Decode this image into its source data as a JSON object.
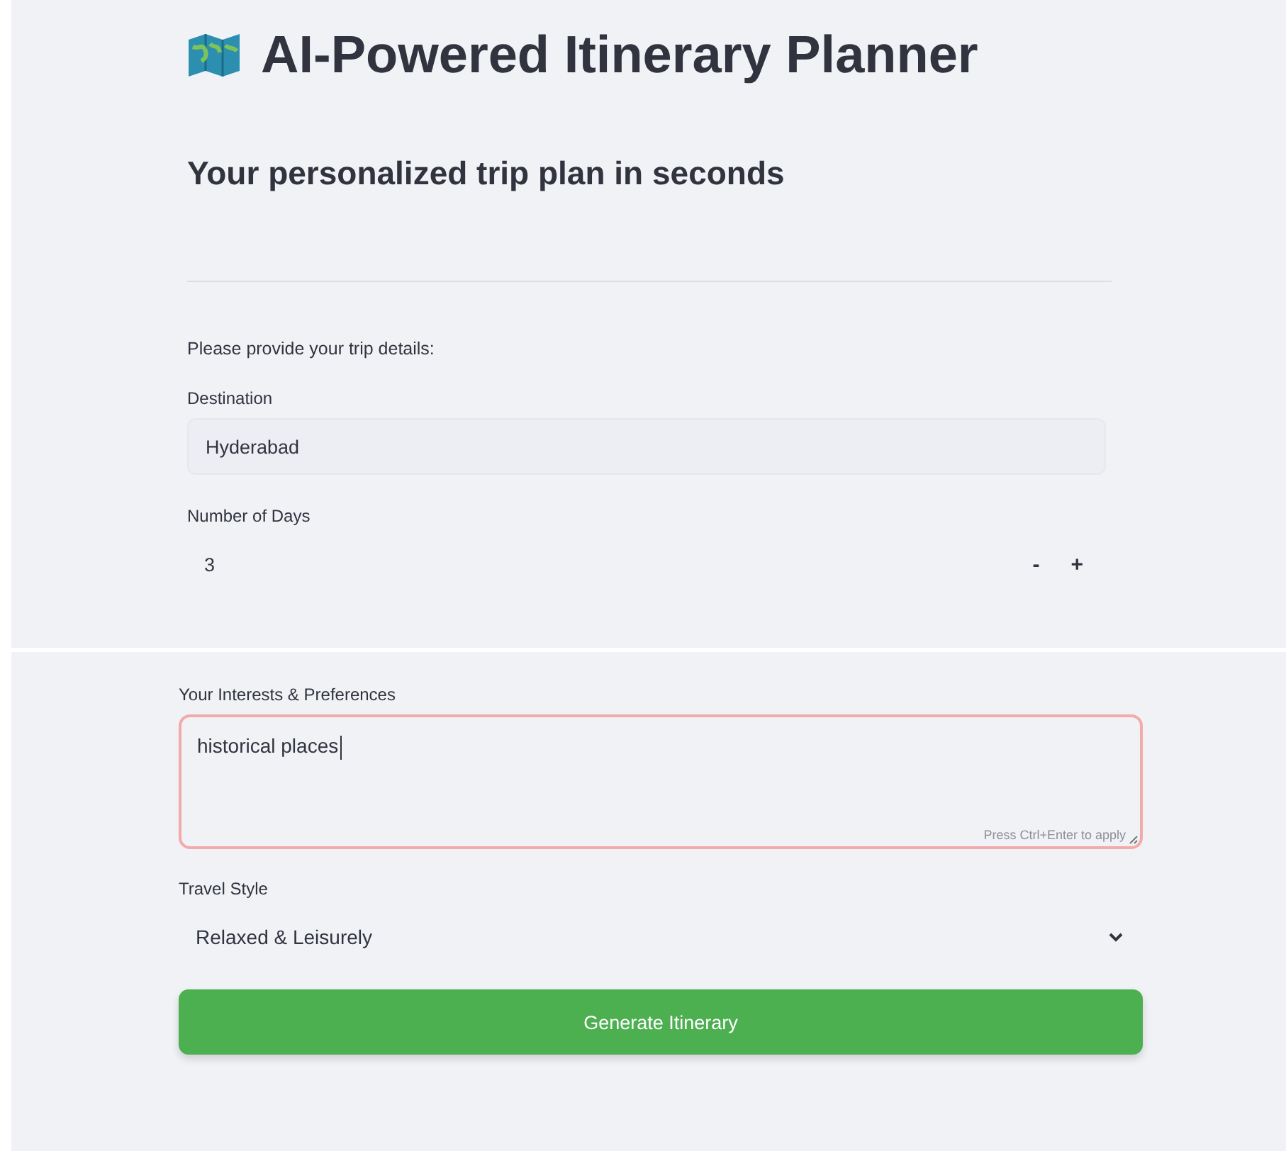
{
  "header": {
    "title": "AI-Powered Itinerary Planner",
    "subtitle": "Your personalized trip plan in seconds"
  },
  "intro": "Please provide your trip details:",
  "fields": [
    {
      "kind": "text",
      "label": "Destination",
      "value": "Hyderabad"
    },
    {
      "kind": "number",
      "label": "Number of Days",
      "value": "3",
      "decrement": "-",
      "increment": "+"
    }
  ],
  "second_screen": {
    "fields": [
      {
        "kind": "textarea",
        "label": "Your Interests & Preferences",
        "value": "historical places",
        "focused": true,
        "hint": "Press Ctrl+Enter to apply"
      },
      {
        "kind": "select",
        "label": "Travel Style",
        "value": "Relaxed & Leisurely"
      }
    ],
    "button": "Generate Itinerary"
  }
}
